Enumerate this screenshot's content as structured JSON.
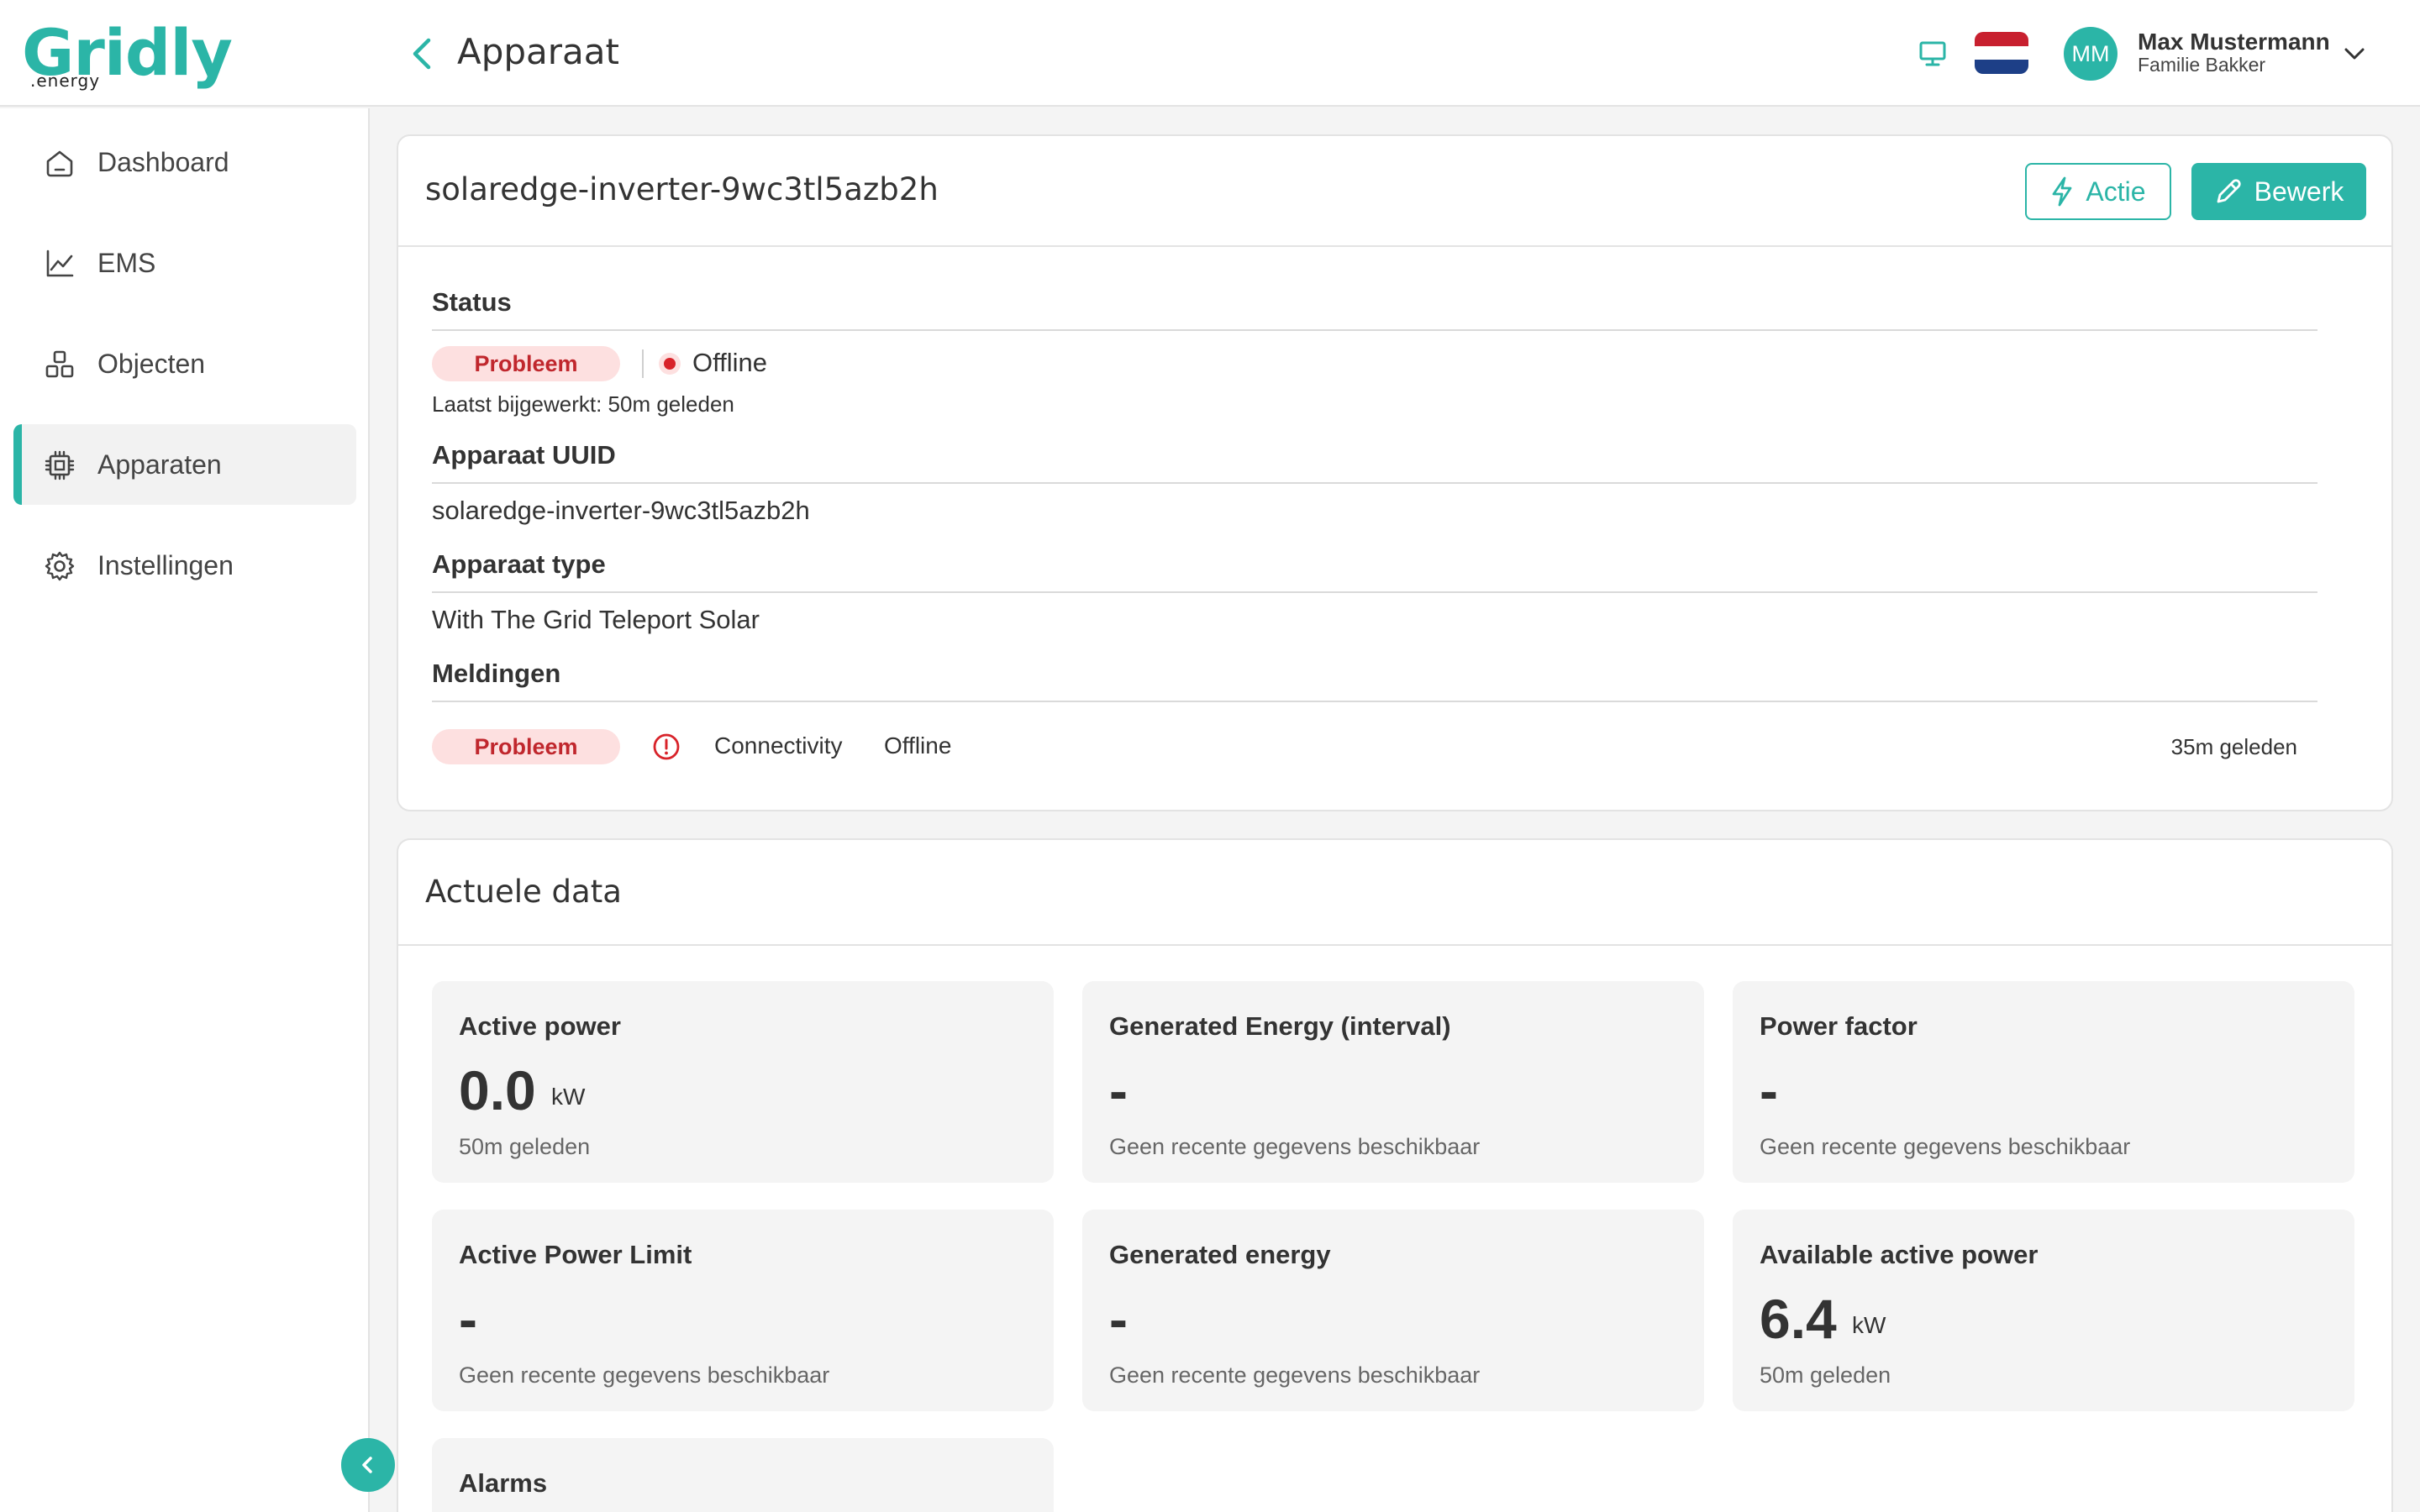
{
  "header": {
    "logo": "Gridly",
    "logo_sub": ".energy",
    "title": "Apparaat",
    "user": {
      "initials": "MM",
      "name": "Max Mustermann",
      "sub": "Familie Bakker"
    }
  },
  "colors": {
    "accent": "#2bb5a7",
    "problem_bg": "#fde0e0",
    "problem_fg": "#c0272d"
  },
  "sidebar": {
    "items": [
      {
        "label": "Dashboard",
        "icon": "home-icon",
        "active": false
      },
      {
        "label": "EMS",
        "icon": "line-chart-icon",
        "active": false
      },
      {
        "label": "Objecten",
        "icon": "boxes-icon",
        "active": false
      },
      {
        "label": "Apparaten",
        "icon": "chip-icon",
        "active": true
      },
      {
        "label": "Instellingen",
        "icon": "gear-icon",
        "active": false
      }
    ]
  },
  "device": {
    "name": "solaredge-inverter-9wc3tl5azb2h",
    "action_label": "Actie",
    "edit_label": "Bewerk",
    "status_label": "Status",
    "status_badge": "Probleem",
    "connection": "Offline",
    "updated": "Laatst bijgewerkt: 50m geleden",
    "uuid_label": "Apparaat UUID",
    "uuid": "solaredge-inverter-9wc3tl5azb2h",
    "type_label": "Apparaat type",
    "type": "With The Grid Teleport Solar",
    "notifications_label": "Meldingen",
    "notifications": [
      {
        "badge": "Probleem",
        "category": "Connectivity",
        "message": "Offline",
        "time": "35m geleden"
      }
    ]
  },
  "live": {
    "title": "Actuele data",
    "tiles": [
      {
        "title": "Active power",
        "value": "0.0",
        "unit": "kW",
        "sub": "50m geleden"
      },
      {
        "title": "Generated Energy (interval)",
        "value": "-",
        "unit": "",
        "sub": "Geen recente gegevens beschikbaar"
      },
      {
        "title": "Power factor",
        "value": "-",
        "unit": "",
        "sub": "Geen recente gegevens beschikbaar"
      },
      {
        "title": "Active Power Limit",
        "value": "-",
        "unit": "",
        "sub": "Geen recente gegevens beschikbaar"
      },
      {
        "title": "Generated energy",
        "value": "-",
        "unit": "",
        "sub": "Geen recente gegevens beschikbaar"
      },
      {
        "title": "Available active power",
        "value": "6.4",
        "unit": "kW",
        "sub": "50m geleden"
      },
      {
        "title": "Alarms",
        "value": "",
        "unit": "",
        "sub": ""
      }
    ]
  }
}
